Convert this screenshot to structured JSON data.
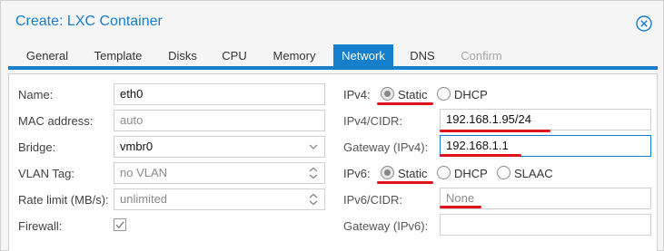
{
  "dialog": {
    "title": "Create: LXC Container"
  },
  "tabs": [
    {
      "label": "General"
    },
    {
      "label": "Template"
    },
    {
      "label": "Disks"
    },
    {
      "label": "CPU"
    },
    {
      "label": "Memory"
    },
    {
      "label": "Network"
    },
    {
      "label": "DNS"
    },
    {
      "label": "Confirm"
    }
  ],
  "active_tab": "Network",
  "left": {
    "name": {
      "label": "Name:",
      "value": "eth0"
    },
    "mac": {
      "label": "MAC address:",
      "placeholder": "auto"
    },
    "bridge": {
      "label": "Bridge:",
      "value": "vmbr0"
    },
    "vlan": {
      "label": "VLAN Tag:",
      "placeholder": "no VLAN"
    },
    "rate": {
      "label": "Rate limit (MB/s):",
      "placeholder": "unlimited"
    },
    "firewall": {
      "label": "Firewall:",
      "checked": true
    }
  },
  "right": {
    "ipv4": {
      "label": "IPv4:",
      "options": [
        "Static",
        "DHCP"
      ],
      "selected": "Static"
    },
    "ipv4_cidr": {
      "label": "IPv4/CIDR:",
      "value": "192.168.1.95/24"
    },
    "gateway4": {
      "label": "Gateway (IPv4):",
      "value": "192.168.1.1"
    },
    "ipv6": {
      "label": "IPv6:",
      "options": [
        "Static",
        "DHCP",
        "SLAAC"
      ],
      "selected": "Static"
    },
    "ipv6_cidr": {
      "label": "IPv6/CIDR:",
      "value": "None"
    },
    "gateway6": {
      "label": "Gateway (IPv6):",
      "value": ""
    }
  },
  "colors": {
    "accent": "#157fcc",
    "annotation": "#e0111b"
  }
}
